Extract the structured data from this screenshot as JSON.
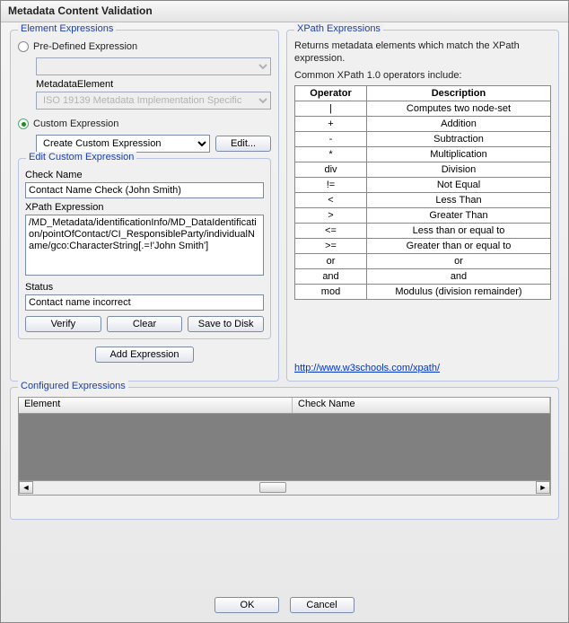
{
  "window": {
    "title": "Metadata Content Validation"
  },
  "elementExpr": {
    "legend": "Element Expressions",
    "predefLabel": "Pre-Defined Expression",
    "predefDropdown": "",
    "metaElemLabel": "MetadataElement",
    "metaElemDropdown": "ISO 19139 Metadata Implementation Specific",
    "customLabel": "Custom Expression",
    "customDropdown": "Create Custom Expression",
    "editBtn": "Edit...",
    "editGroup": {
      "legend": "Edit Custom Expression",
      "checkNameLabel": "Check Name",
      "checkName": "Contact Name Check (John Smith)",
      "xpathLabel": "XPath Expression",
      "xpath": "/MD_Metadata/identificationInfo/MD_DataIdentification/pointOfContact/CI_ResponsibleParty/individualName/gco:CharacterString[.=!'John Smith']",
      "statusLabel": "Status",
      "status": "Contact name incorrect",
      "verify": "Verify",
      "clear": "Clear",
      "save": "Save to Disk"
    },
    "addBtn": "Add Expression"
  },
  "xpathExpr": {
    "legend": "XPath Expressions",
    "desc": "Returns metadata elements which match the XPath expression.",
    "subhead": "Common XPath 1.0 operators include:",
    "th1": "Operator",
    "th2": "Description",
    "rows": [
      {
        "op": "|",
        "desc": "Computes two node-set"
      },
      {
        "op": "+",
        "desc": "Addition"
      },
      {
        "op": "-",
        "desc": "Subtraction"
      },
      {
        "op": "*",
        "desc": "Multiplication"
      },
      {
        "op": "div",
        "desc": "Division"
      },
      {
        "op": "!=",
        "desc": "Not Equal"
      },
      {
        "op": "<",
        "desc": "Less Than"
      },
      {
        "op": ">",
        "desc": "Greater Than"
      },
      {
        "op": "<=",
        "desc": "Less than or equal to"
      },
      {
        "op": ">=",
        "desc": "Greater than or equal to"
      },
      {
        "op": "or",
        "desc": "or"
      },
      {
        "op": "and",
        "desc": "and"
      },
      {
        "op": "mod",
        "desc": "Modulus (division remainder)"
      }
    ],
    "link": "http://www.w3schools.com/xpath/"
  },
  "configured": {
    "legend": "Configured Expressions",
    "col1": "Element",
    "col2": "Check Name"
  },
  "footer": {
    "ok": "OK",
    "cancel": "Cancel"
  }
}
